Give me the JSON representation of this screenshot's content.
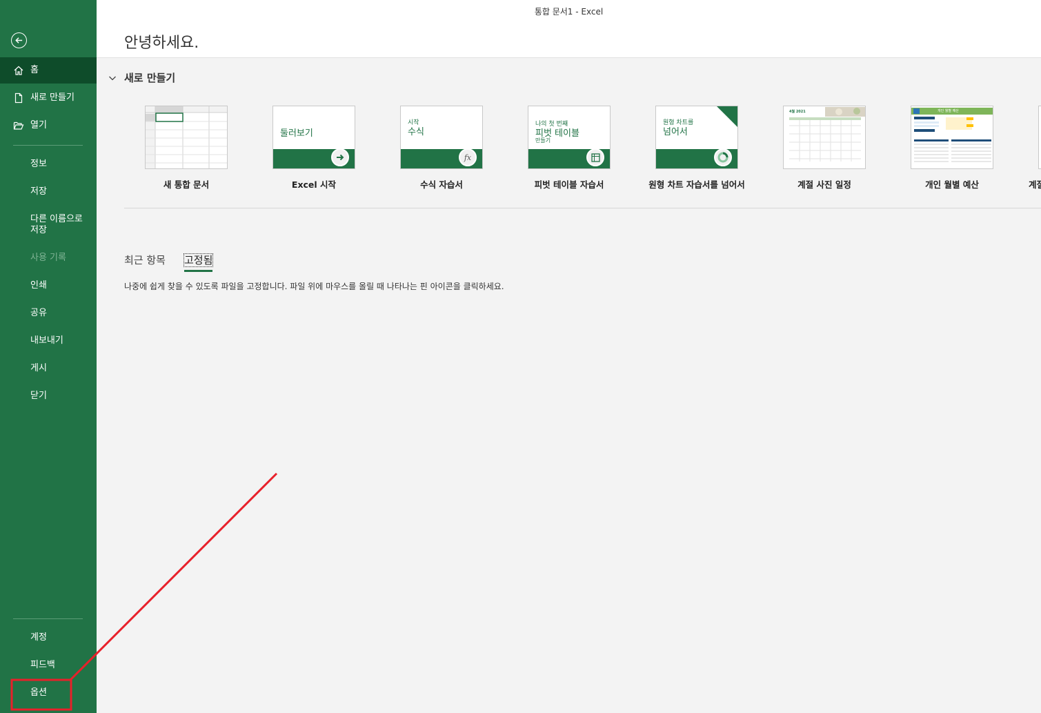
{
  "window": {
    "title": "통합 문서1  -  Excel"
  },
  "sidebar": {
    "top_items": [
      {
        "label": "홈",
        "icon": "home-icon"
      },
      {
        "label": "새로 만들기",
        "icon": "new-document-icon"
      },
      {
        "label": "열기",
        "icon": "open-folder-icon"
      }
    ],
    "items": [
      {
        "label": "정보"
      },
      {
        "label": "저장"
      },
      {
        "label": "다른 이름으로 저장"
      },
      {
        "label": "사용 기록"
      },
      {
        "label": "인쇄"
      },
      {
        "label": "공유"
      },
      {
        "label": "내보내기"
      },
      {
        "label": "게시"
      },
      {
        "label": "닫기"
      }
    ],
    "bottom_items": [
      {
        "label": "계정"
      },
      {
        "label": "피드백"
      },
      {
        "label": "옵션"
      }
    ]
  },
  "main": {
    "greeting": "안녕하세요.",
    "new_section_title": "새로 만들기",
    "templates": [
      {
        "name": "새 통합 문서"
      },
      {
        "name": "Excel 시작",
        "thumb_text": "둘러보기"
      },
      {
        "name": "수식 자습서",
        "thumb_small": "시작",
        "thumb_text": "수식"
      },
      {
        "name": "피벗 테이블 자습서",
        "thumb_small": "나의 첫 번째",
        "thumb_text": "피벗 테이블",
        "thumb_sub": "만들기"
      },
      {
        "name": "원형 차트 자습서를 넘어서",
        "thumb_small": "원형 차트를",
        "thumb_text": "넘어서"
      },
      {
        "name": "계절 사진 일정",
        "thumb_text": "4월 2021"
      },
      {
        "name": "개인 월별 예산",
        "thumb_text": "개인 월별 예산"
      },
      {
        "name": "계절"
      }
    ],
    "tabs": [
      {
        "label": "최근 항목"
      },
      {
        "label": "고정됨"
      }
    ],
    "pinned_message": "나중에 쉽게 찾을 수 있도록 파일을 고정합니다. 파일 위에 마우스를 올릴 때 나타나는 핀 아이콘을 클릭하세요."
  },
  "colors": {
    "accent": "#217346",
    "active_nav": "#0e4c2a",
    "annotation": "#e8202a"
  }
}
